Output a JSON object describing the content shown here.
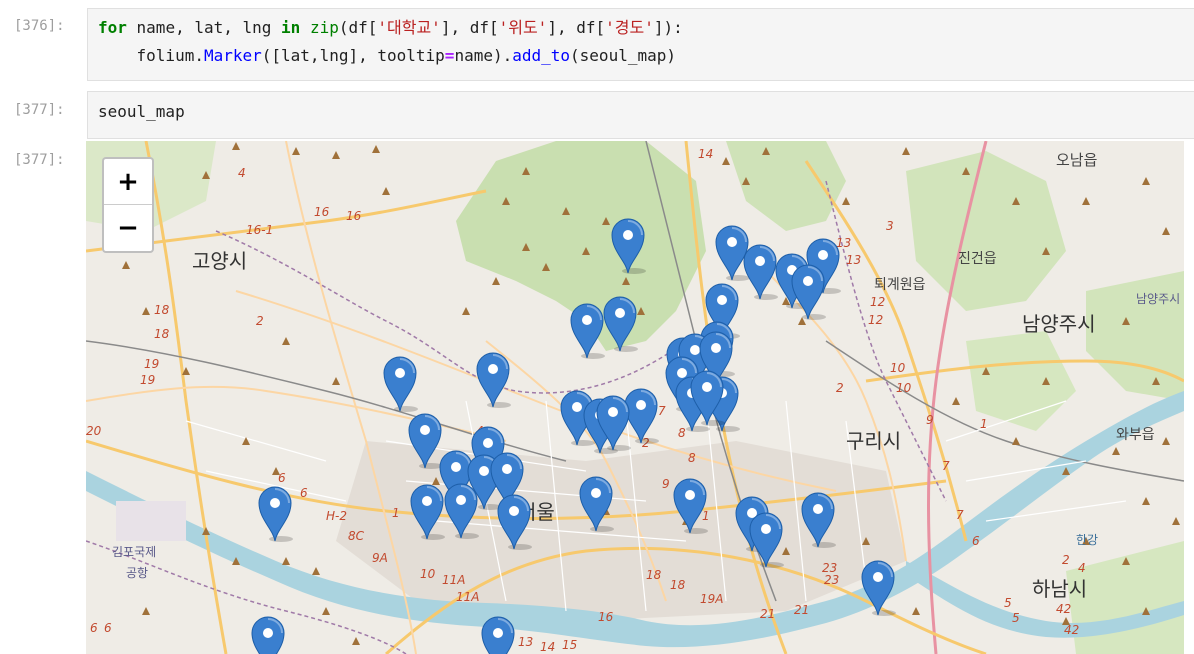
{
  "cells": [
    {
      "prompt": "[376]:",
      "code": [
        [
          {
            "t": "for",
            "c": "kw"
          },
          {
            "t": " name, lat, lng "
          },
          {
            "t": "in",
            "c": "kw"
          },
          {
            "t": " "
          },
          {
            "t": "zip",
            "c": "bi"
          },
          {
            "t": "(df["
          },
          {
            "t": "'대학교'",
            "c": "str"
          },
          {
            "t": "], df["
          },
          {
            "t": "'위도'",
            "c": "str"
          },
          {
            "t": "], df["
          },
          {
            "t": "'경도'",
            "c": "str"
          },
          {
            "t": "]):"
          }
        ],
        [
          {
            "t": "    folium."
          },
          {
            "t": "Marker",
            "c": "cls"
          },
          {
            "t": "([lat,lng], tooltip"
          },
          {
            "t": "=",
            "c": "op"
          },
          {
            "t": "name)."
          },
          {
            "t": "add_to",
            "c": "fn"
          },
          {
            "t": "(seoul_map)"
          }
        ]
      ]
    },
    {
      "prompt": "[377]:",
      "code": [
        [
          {
            "t": "seoul_map"
          }
        ]
      ]
    }
  ],
  "output_prompt": "[377]:",
  "zoom": {
    "in_label": "+",
    "out_label": "−"
  },
  "map_labels": [
    {
      "text": "오남읍",
      "cls": "small"
    },
    {
      "text": "고양시",
      "cls": "big"
    },
    {
      "text": "퇴계원읍",
      "cls": "small"
    },
    {
      "text": "진건읍",
      "cls": "small"
    },
    {
      "text": "남양주시",
      "cls": "big"
    },
    {
      "text": "남양주시",
      "cls": "tiny"
    },
    {
      "text": "구리시",
      "cls": "big"
    },
    {
      "text": "와부읍",
      "cls": "small"
    },
    {
      "text": "서울",
      "cls": "big"
    },
    {
      "text": "김포국제",
      "cls": "tiny"
    },
    {
      "text": "공항",
      "cls": "tiny"
    },
    {
      "text": "한강",
      "cls": "tiny"
    },
    {
      "text": "하남시",
      "cls": "big"
    }
  ],
  "road_numbers": [
    "14",
    "4",
    "16",
    "16",
    "16-1",
    "3",
    "13",
    "13",
    "18",
    "18",
    "2",
    "19",
    "19",
    "12",
    "12",
    "2",
    "10",
    "10",
    "20",
    "7",
    "4",
    "9",
    "1",
    "2",
    "7",
    "8",
    "8",
    "H-2",
    "1",
    "8C",
    "9A",
    "6",
    "6",
    "9",
    "1",
    "10",
    "11A",
    "11A",
    "18",
    "18",
    "19A",
    "21",
    "21",
    "23",
    "23",
    "5",
    "42",
    "42",
    "16",
    "13",
    "14",
    "15",
    "6",
    "6",
    "6",
    "7",
    "2",
    "4",
    "5"
  ],
  "markers_count": 40,
  "colors": {
    "marker": "#3a7fcf",
    "water": "#aad3df",
    "forest": "#cce0b4",
    "urban": "#e4dfd9",
    "road_major": "#f7c96d",
    "road_minor": "#ffffff",
    "prompt": "#9e9e9e"
  }
}
